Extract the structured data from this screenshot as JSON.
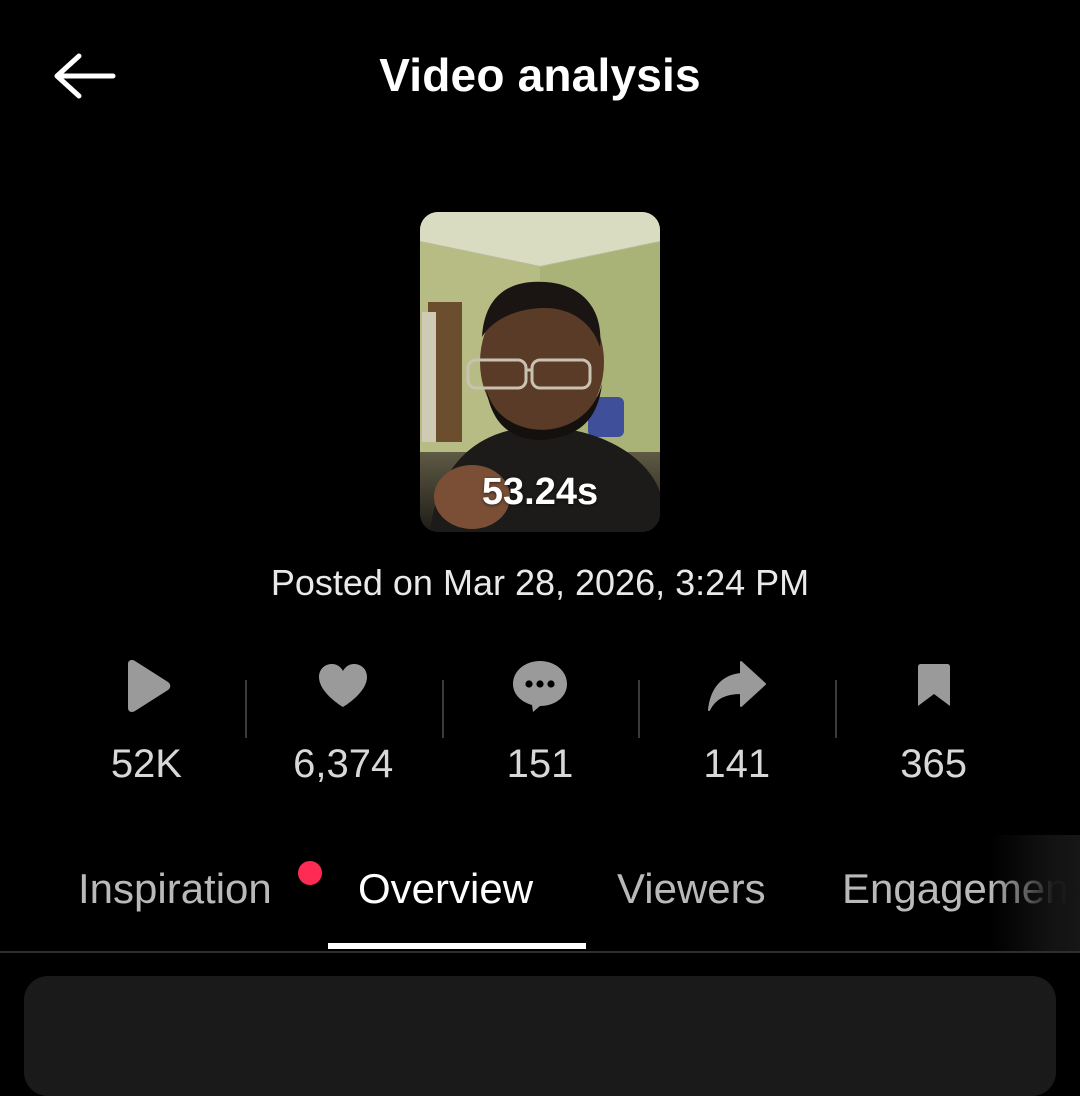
{
  "header": {
    "title": "Video analysis",
    "back_icon": "arrow-left-icon"
  },
  "video": {
    "duration": "53.24s",
    "posted": "Posted on Mar 28, 2026, 3:24 PM"
  },
  "stats": {
    "views": {
      "icon": "play-icon",
      "value": "52K"
    },
    "likes": {
      "icon": "heart-icon",
      "value": "6,374"
    },
    "comments": {
      "icon": "comment-icon",
      "value": "151"
    },
    "shares": {
      "icon": "share-icon",
      "value": "141"
    },
    "saves": {
      "icon": "bookmark-icon",
      "value": "365"
    }
  },
  "tabs": [
    {
      "label": "Inspiration",
      "has_notification": true
    },
    {
      "label": "Overview",
      "active": true
    },
    {
      "label": "Viewers"
    },
    {
      "label": "Engagemen"
    }
  ],
  "colors": {
    "background": "#000000",
    "notification_dot": "#fe2c55",
    "stat_icon": "#9a9a9a",
    "inactive_tab": "#b9b9b9"
  }
}
